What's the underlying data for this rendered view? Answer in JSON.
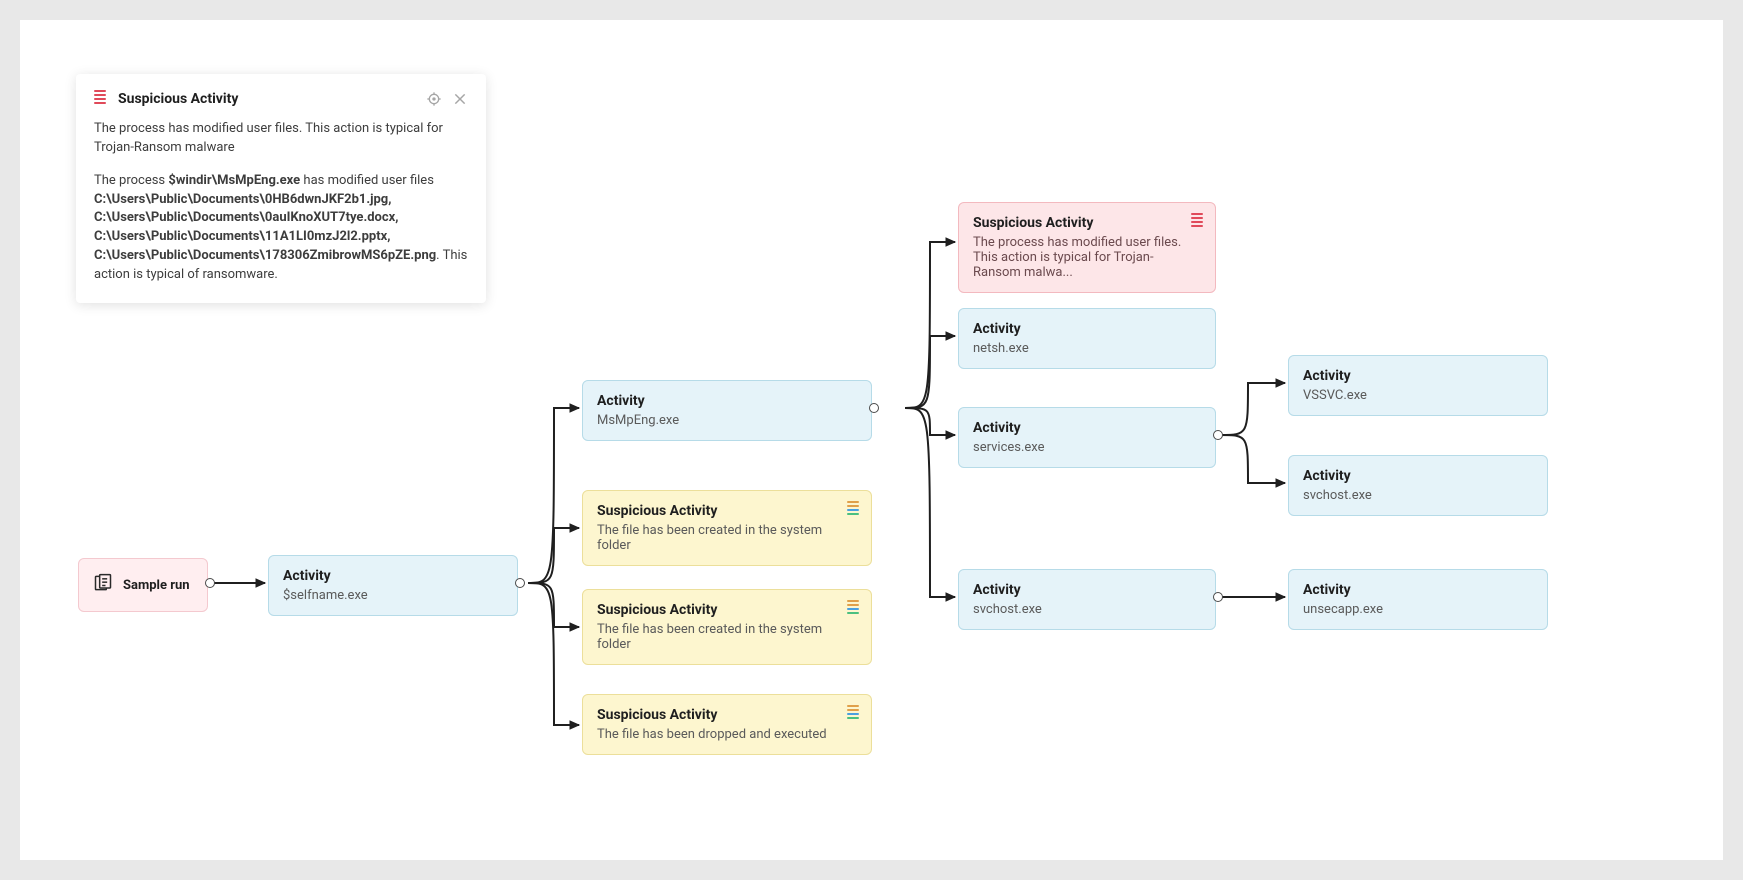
{
  "panel": {
    "title": "Suspicious Activity",
    "description": "The process has modified user files. This action is typical for Trojan-Ransom malware",
    "body_prefix": "The process ",
    "proc_path": "$windir\\MsMpEng.exe",
    "body_mid": " has modified user files ",
    "files": "C:\\Users\\Public\\Documents\\0HB6dwnJKF2b1.jpg, C:\\Users\\Public\\Documents\\0auIKnoXUT7tye.docx, C:\\Users\\Public\\Documents\\11A1LI0mzJ2l2.pptx, C:\\Users\\Public\\Documents\\178306ZmibrowMS6pZE.png",
    "body_suffix": ". This action is typical of ransomware."
  },
  "nodes": {
    "root": {
      "title": "Sample run"
    },
    "activity_self": {
      "title": "Activity",
      "sub": "$selfname.exe"
    },
    "act_msmpeng": {
      "title": "Activity",
      "sub": "MsMpEng.exe"
    },
    "susp_sys1": {
      "title": "Suspicious Activity",
      "sub": "The file has been created in the system folder"
    },
    "susp_sys2": {
      "title": "Suspicious Activity",
      "sub": "The file has been created in the system folder"
    },
    "susp_drop": {
      "title": "Suspicious Activity",
      "sub": "The file has been dropped and executed"
    },
    "susp_mod": {
      "title": "Suspicious Activity",
      "sub": "The process has modified user files. This action is typical for Trojan-Ransom malwa..."
    },
    "act_netsh": {
      "title": "Activity",
      "sub": "netsh.exe"
    },
    "act_services": {
      "title": "Activity",
      "sub": "services.exe"
    },
    "act_svchost1": {
      "title": "Activity",
      "sub": "svchost.exe"
    },
    "act_vssvc": {
      "title": "Activity",
      "sub": "VSSVC.exe"
    },
    "act_svchost2": {
      "title": "Activity",
      "sub": "svchost.exe"
    },
    "act_unsecapp": {
      "title": "Activity",
      "sub": "unsecapp.exe"
    }
  }
}
